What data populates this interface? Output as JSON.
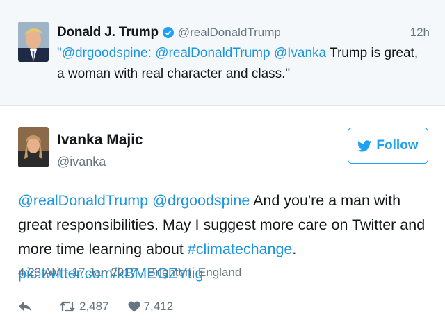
{
  "parent_tweet": {
    "name": "Donald J. Trump",
    "handle": "@realDonaldTrump",
    "time": "12h",
    "text_segments": [
      {
        "text": "\"@drgoodspine: ",
        "link": true
      },
      {
        "text": "@realDonaldTrump",
        "link": true
      },
      {
        "text": " ",
        "link": false
      },
      {
        "text": "@Ivanka",
        "link": true
      },
      {
        "text": " Trump is great, a woman with real character and class.\"",
        "link": false
      }
    ]
  },
  "main_tweet": {
    "name": "Ivanka Majic",
    "handle": "@ivanka",
    "follow_label": "Follow",
    "text_segments": [
      {
        "text": "@realDonaldTrump",
        "link": true
      },
      {
        "text": " ",
        "link": false
      },
      {
        "text": "@drgoodspine",
        "link": true
      },
      {
        "text": " And you're a man with great responsibilities. May I suggest more care on Twitter and more time learning about ",
        "link": false
      },
      {
        "text": "#climatechange",
        "link": true
      },
      {
        "text": ". ",
        "link": false
      },
      {
        "text": "pic.twitter.com/kBMEGZYtig",
        "link": true
      }
    ],
    "meta": "4:23 AM - 17 Jan 2017 · Brighton, England",
    "retweet_count": "2,487",
    "like_count": "7,412"
  },
  "icons": {
    "verified": "verified-badge-icon",
    "bird": "twitter-bird-icon",
    "reply": "reply-icon",
    "retweet": "retweet-icon",
    "like": "heart-icon"
  },
  "colors": {
    "link": "#1b95e0",
    "accent": "#1da1f2",
    "muted": "#66757f",
    "parent_background": "#f5f8fa",
    "divider": "#e1e8ed"
  }
}
